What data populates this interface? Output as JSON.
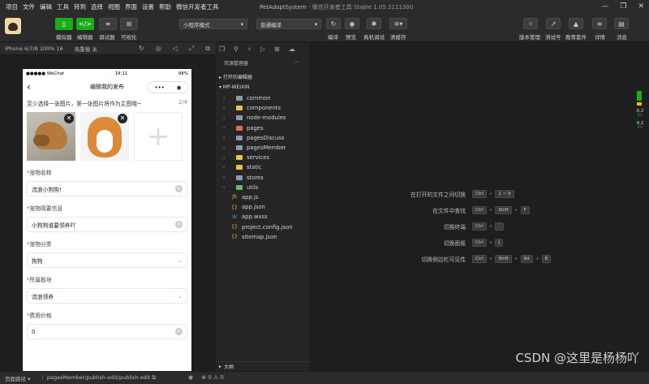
{
  "menu": [
    "项目",
    "文件",
    "编辑",
    "工具",
    "转到",
    "选择",
    "视图",
    "界面",
    "设置",
    "帮助",
    "微信开发者工具"
  ],
  "window": {
    "project": "PetAdoptSystem",
    "app": "微信开发者工具 Stable 1.05.2111300"
  },
  "toolbar": {
    "modes": [
      "模拟器",
      "编辑器",
      "调试器",
      "可视化"
    ],
    "mode_select": "小程序模式",
    "compile_select": "普通编译",
    "actions": [
      "编译",
      "预览",
      "真机调试",
      "清缓存"
    ],
    "right_actions": [
      "版本管理",
      "测试号",
      "教育套件",
      "详情",
      "消息"
    ]
  },
  "simulator": {
    "device": "iPhone 6/7/8 100% 16",
    "network": "热重载 关"
  },
  "phone": {
    "carrier": "●●●●● WeChat",
    "time": "19:11",
    "battery": "98%",
    "nav_title": "编辑我的发布",
    "hint": "至少选择一张图片，第一张图片将作为主图哦~",
    "count": "2/4",
    "fields": [
      {
        "label": "宠物名称",
        "value": "流浪小狗狗!",
        "type": "input"
      },
      {
        "label": "宠物简要信息",
        "value": "小狗狗谁要领养吖",
        "type": "input"
      },
      {
        "label": "宠物分类",
        "value": "狗狗",
        "type": "select"
      },
      {
        "label": "所属板块",
        "value": "流浪领养",
        "type": "select"
      },
      {
        "label": "费用价格",
        "value": "0",
        "type": "input"
      }
    ]
  },
  "explorer": {
    "title": "资源管理器",
    "open_editors": "打开的编辑器",
    "root": "MP-WEIXIN",
    "folders": [
      {
        "name": "common",
        "color": "#8d9aa8"
      },
      {
        "name": "components",
        "color": "#e8c34a"
      },
      {
        "name": "node-modules",
        "color": "#8d9aa8"
      },
      {
        "name": "pages",
        "color": "#e06c5a"
      },
      {
        "name": "pagesDiscuss",
        "color": "#8d9aa8"
      },
      {
        "name": "pagesMember",
        "color": "#8d9aa8"
      },
      {
        "name": "services",
        "color": "#e8c34a"
      },
      {
        "name": "static",
        "color": "#e8c34a"
      },
      {
        "name": "stores",
        "color": "#8d9aa8"
      },
      {
        "name": "utils",
        "color": "#6cb86c"
      }
    ],
    "files": [
      {
        "name": "app.js",
        "icon": "JS",
        "color": "#e8c34a"
      },
      {
        "name": "app.json",
        "icon": "{}",
        "color": "#e8c34a"
      },
      {
        "name": "app.wxss",
        "icon": "W",
        "color": "#4a9ee8"
      },
      {
        "name": "project.config.json",
        "icon": "{}",
        "color": "#e8c34a"
      },
      {
        "name": "sitemap.json",
        "icon": "{}",
        "color": "#e8c34a"
      }
    ],
    "outline": "大纲"
  },
  "shortcuts": [
    {
      "label": "在打开的文件之间切换",
      "keys": [
        "Ctrl",
        "1 ~ 9"
      ]
    },
    {
      "label": "在文件中查找",
      "keys": [
        "Ctrl",
        "Shift",
        "F"
      ]
    },
    {
      "label": "切换终端",
      "keys": [
        "Ctrl",
        "`"
      ]
    },
    {
      "label": "切换面板",
      "keys": [
        "Ctrl",
        "J"
      ]
    },
    {
      "label": "切换侧边栏可见性",
      "keys": [
        "Ctrl",
        "Shift",
        "Alt",
        "B"
      ]
    }
  ],
  "meters": [
    {
      "value": "0.2",
      "unit": "K/s"
    },
    {
      "value": "0.2",
      "unit": "K/s"
    }
  ],
  "statusbar": {
    "page_path_label": "页面路径",
    "path": "pagesMember/publish-edit/publish-edit",
    "problems": "⊗ 0 ⚠ 0"
  },
  "watermark": "CSDN @这里是杨杨吖"
}
